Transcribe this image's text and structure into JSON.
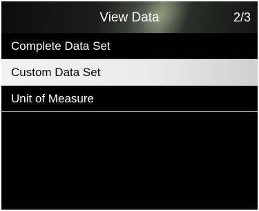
{
  "header": {
    "title": "View Data",
    "page_indicator": "2/3"
  },
  "menu": {
    "items": [
      {
        "label": "Complete Data Set",
        "selected": false
      },
      {
        "label": "Custom Data Set",
        "selected": true
      },
      {
        "label": "Unit of Measure",
        "selected": false
      }
    ]
  },
  "colors": {
    "background": "#000000",
    "selected_background": "#ebebeb",
    "text": "#ffffff",
    "selected_text": "#000000"
  }
}
